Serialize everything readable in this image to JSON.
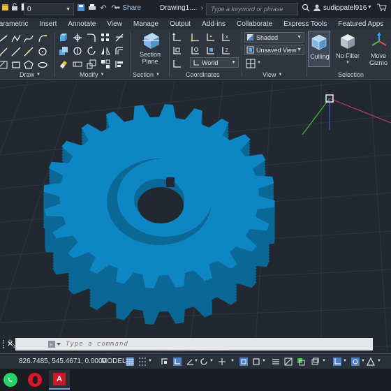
{
  "titlebar": {
    "layer_value": "0",
    "share_label": "Share",
    "document_title": "Drawing1....",
    "search_placeholder": "Type a keyword or phrase",
    "username": "sudippatel916"
  },
  "ribbon_tabs": [
    "Parametric",
    "Insert",
    "Annotate",
    "View",
    "Manage",
    "Output",
    "Add-ins",
    "Collaborate",
    "Express Tools",
    "Featured Apps"
  ],
  "ribbon": {
    "panels": {
      "draw": "Draw",
      "modify": "Modify",
      "section": "Section",
      "coordinates": "Coordinates",
      "view": "View",
      "selection": "Selection"
    },
    "section_plane_line1": "Section",
    "section_plane_line2": "Plane",
    "visual_style": "Shaded",
    "named_view": "Unsaved View",
    "ucs": "World",
    "culling_label": "Culling",
    "no_filter_label": "No Filter",
    "move_gizmo_line1": "Move",
    "move_gizmo_line2": "Gizmo"
  },
  "command": {
    "placeholder": "Type a command"
  },
  "status": {
    "coordinates": "826.7485, 545.4671, 0.0000",
    "space": "MODEL"
  },
  "colors": {
    "gear": "#0f86c4",
    "gear_shadow": "#0a6796",
    "viewport_bg": "#212830"
  }
}
